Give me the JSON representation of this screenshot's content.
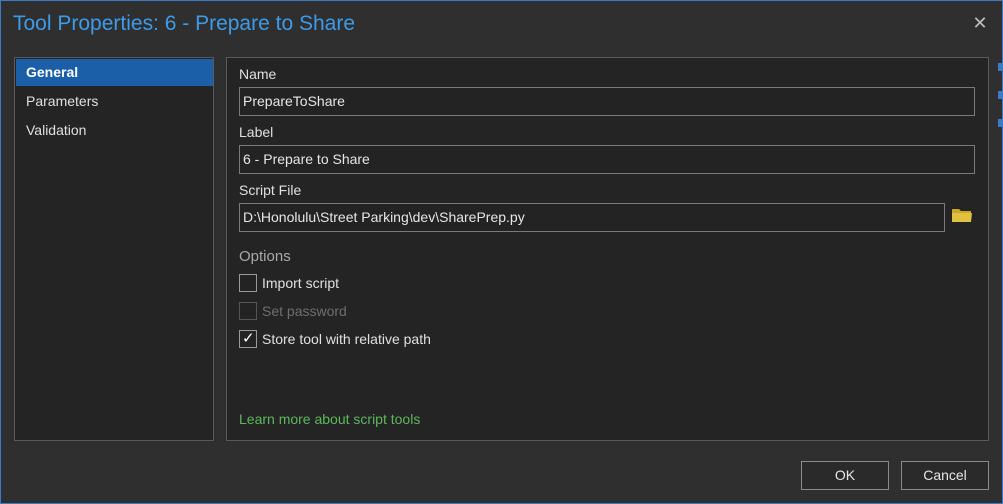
{
  "window": {
    "title": "Tool Properties: 6 - Prepare to Share",
    "close_glyph": "✕"
  },
  "nav": {
    "items": [
      {
        "label": "General",
        "active": true
      },
      {
        "label": "Parameters",
        "active": false
      },
      {
        "label": "Validation",
        "active": false
      }
    ]
  },
  "general": {
    "name_label": "Name",
    "name_value": "PrepareToShare",
    "label_label": "Label",
    "label_value": "6 - Prepare to Share",
    "script_label": "Script File",
    "script_value": "D:\\Honolulu\\Street Parking\\dev\\SharePrep.py",
    "browse_icon": "folder-icon",
    "options_title": "Options",
    "options": [
      {
        "label": "Import script",
        "checked": false,
        "enabled": true
      },
      {
        "label": "Set password",
        "checked": false,
        "enabled": false
      },
      {
        "label": "Store tool with relative path",
        "checked": true,
        "enabled": true
      }
    ],
    "learn_more": "Learn more about script tools"
  },
  "buttons": {
    "ok": "OK",
    "cancel": "Cancel"
  },
  "colors": {
    "accent": "#3d9be9",
    "nav_active": "#1a5fa8",
    "link": "#5cb85c",
    "folder": "#c8a92a"
  }
}
